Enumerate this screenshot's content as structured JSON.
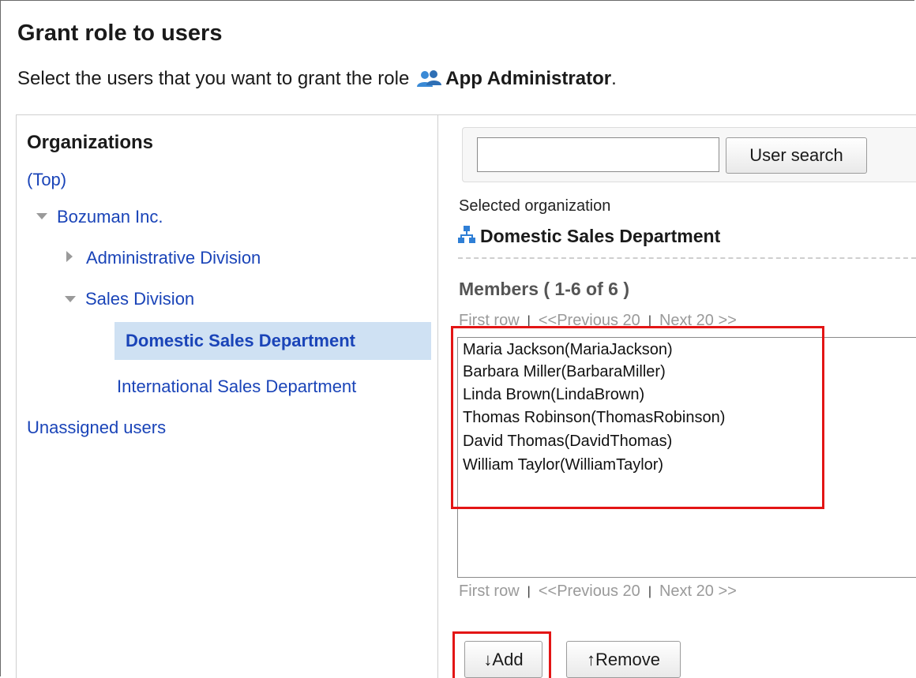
{
  "header": {
    "title": "Grant role to users",
    "subtitle_prefix": "Select the users that you want to grant the role",
    "role_icon": "users-icon",
    "role_name": "App Administrator",
    "subtitle_suffix": "."
  },
  "organizations": {
    "heading": "Organizations",
    "top_link": "(Top)",
    "tree": [
      {
        "label": "Bozuman Inc.",
        "expanded": true
      },
      {
        "label": "Administrative Division",
        "expanded": false
      },
      {
        "label": "Sales Division",
        "expanded": true
      },
      {
        "label": "Domestic Sales Department",
        "selected": true
      },
      {
        "label": "International Sales Department"
      }
    ],
    "unassigned": "Unassigned users"
  },
  "search": {
    "input_value": "",
    "button_label": "User search"
  },
  "selected_org": {
    "label": "Selected organization",
    "icon": "org-tree-icon",
    "name": "Domestic Sales Department"
  },
  "members": {
    "title": "Members ( 1-6 of 6 )",
    "pager": {
      "first": "First row",
      "prev": "<<Previous 20",
      "next": "Next 20 >>",
      "sep": "|"
    },
    "list": [
      "Maria Jackson(MariaJackson)",
      "Barbara Miller(BarbaraMiller)",
      "Linda Brown(LindaBrown)",
      "Thomas Robinson(ThomasRobinson)",
      "David Thomas(DavidThomas)",
      "William Taylor(WilliamTaylor)"
    ]
  },
  "actions": {
    "add_label": "↓Add",
    "remove_label": "↑Remove"
  },
  "colors": {
    "link": "#1a44b8",
    "highlight": "#e31515",
    "selected_bg": "#cfe1f3"
  }
}
